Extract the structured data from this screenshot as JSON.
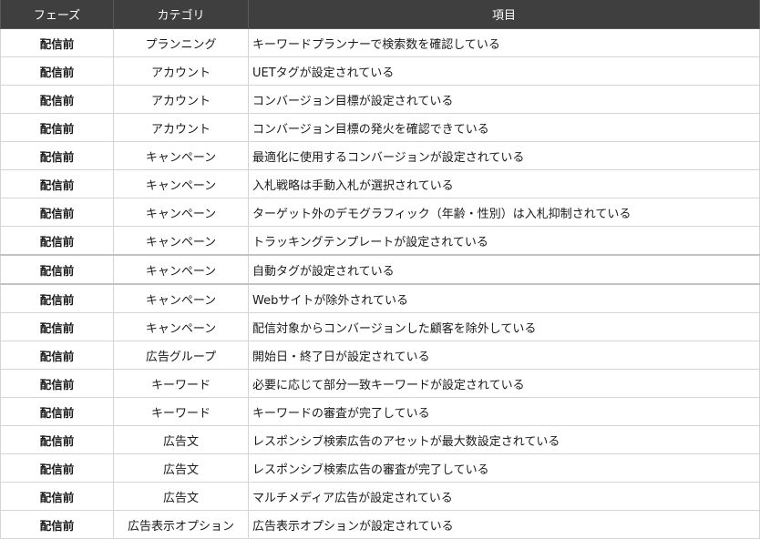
{
  "header": {
    "phase": "フェーズ",
    "category": "カテゴリ",
    "item": "項目"
  },
  "rows": [
    {
      "phase": "配信前",
      "category": "プランニング",
      "item": "キーワードプランナーで検索数を確認している"
    },
    {
      "phase": "配信前",
      "category": "アカウント",
      "item": "UETタグが設定されている"
    },
    {
      "phase": "配信前",
      "category": "アカウント",
      "item": "コンバージョン目標が設定されている"
    },
    {
      "phase": "配信前",
      "category": "アカウント",
      "item": "コンバージョン目標の発火を確認できている"
    },
    {
      "phase": "配信前",
      "category": "キャンペーン",
      "item": "最適化に使用するコンバージョンが設定されている"
    },
    {
      "phase": "配信前",
      "category": "キャンペーン",
      "item": "入札戦略は手動入札が選択されている"
    },
    {
      "phase": "配信前",
      "category": "キャンペーン",
      "item": "ターゲット外のデモグラフィック（年齢・性別）は入札抑制されている"
    },
    {
      "phase": "配信前",
      "category": "キャンペーン",
      "item": "トラッキングテンプレートが設定されている"
    },
    {
      "phase": "配信前",
      "category": "キャンペーン",
      "item": "自動タグが設定されている"
    },
    {
      "phase": "配信前",
      "category": "キャンペーン",
      "item": "Webサイトが除外されている"
    },
    {
      "phase": "配信前",
      "category": "キャンペーン",
      "item": "配信対象からコンバージョンした顧客を除外している"
    },
    {
      "phase": "配信前",
      "category": "広告グループ",
      "item": "開始日・終了日が設定されている"
    },
    {
      "phase": "配信前",
      "category": "キーワード",
      "item": "必要に応じて部分一致キーワードが設定されている"
    },
    {
      "phase": "配信前",
      "category": "キーワード",
      "item": "キーワードの審査が完了している"
    },
    {
      "phase": "配信前",
      "category": "広告文",
      "item": "レスポンシブ検索広告のアセットが最大数設定されている"
    },
    {
      "phase": "配信前",
      "category": "広告文",
      "item": "レスポンシブ検索広告の審査が完了している"
    },
    {
      "phase": "配信前",
      "category": "広告文",
      "item": "マルチメディア広告が設定されている"
    },
    {
      "phase": "配信前",
      "category": "広告表示オプション",
      "item": "広告表示オプションが設定されている"
    }
  ]
}
